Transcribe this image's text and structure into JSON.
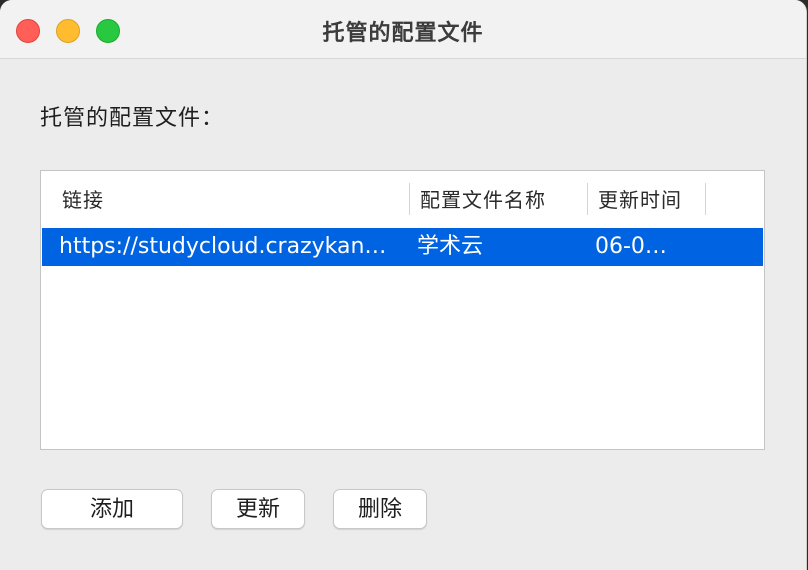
{
  "window": {
    "title": "托管的配置文件"
  },
  "section": {
    "label": "托管的配置文件："
  },
  "table": {
    "columns": [
      "链接",
      "配置文件名称",
      "更新时间"
    ],
    "rows": [
      {
        "link": "https://studycloud.crazykan…",
        "name": "学术云",
        "updated": "06-0…",
        "selected": true
      }
    ]
  },
  "buttons": {
    "add": "添加",
    "update": "更新",
    "delete": "删除"
  },
  "colors": {
    "selection": "#0063e1",
    "close": "#ff5f57",
    "minimize": "#febc2e",
    "maximize": "#28c840"
  }
}
